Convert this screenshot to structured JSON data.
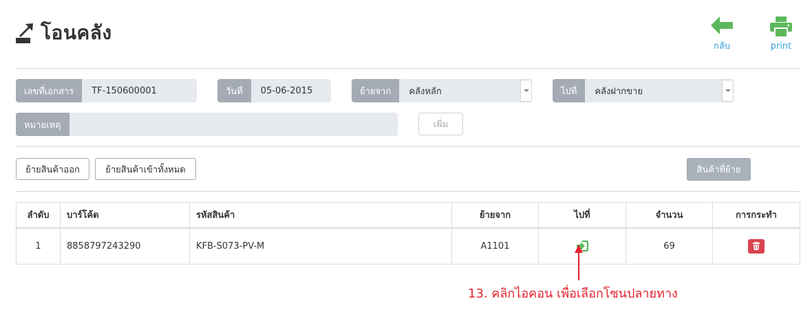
{
  "header": {
    "title": "โอนคลัง",
    "icon": "transfer-out-icon"
  },
  "actions": {
    "back_label": "กลับ",
    "print_label": "print"
  },
  "form": {
    "doc_no_label": "เลขที่เอกสาร",
    "doc_no_value": "TF-150600001",
    "date_label": "วันที่",
    "date_value": "05-06-2015",
    "from_label": "ย้ายจาก",
    "from_value": "คลังหลัก",
    "to_label": "ไปที่",
    "to_value": "คลังฝากขาย",
    "note_label": "หมายเหตุ",
    "note_value": "",
    "add_label": "เพิ่ม"
  },
  "toolbar": {
    "move_out_label": "ย้ายสินค้าออก",
    "move_all_in_label": "ย้ายสินค้าเข้าทั้งหมด",
    "moved_items_label": "สินค้าที่ย้าย"
  },
  "table": {
    "columns": [
      "ลำดับ",
      "บาร์โค้ด",
      "รหัสสินค้า",
      "ย้ายจาก",
      "ไปที่",
      "จำนวน",
      "การกระทำ"
    ],
    "rows": [
      {
        "no": "1",
        "barcode": "8858797243290",
        "product_code": "KFB-S073-PV-M",
        "from": "A1101",
        "qty": "69"
      }
    ]
  },
  "annotation": {
    "text": "13. คลิกไอคอน เพื่อเลือกโซนปลายทาง"
  },
  "colors": {
    "accent_green": "#5cb85c",
    "link_blue": "#3aa0d8",
    "danger": "#d9444f",
    "annotation_red": "#e5232e"
  }
}
